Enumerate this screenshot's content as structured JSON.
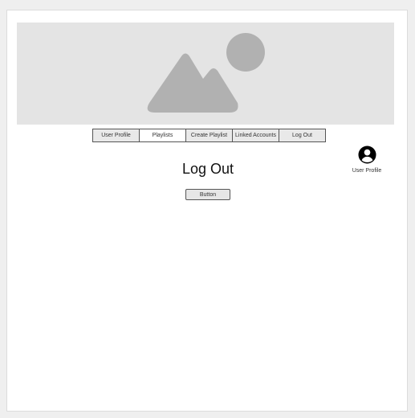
{
  "hero": {
    "icon": "image-placeholder-icon"
  },
  "nav": {
    "items": [
      {
        "label": "User Profile"
      },
      {
        "label": "Playlists",
        "active": true
      },
      {
        "label": "Create Playlist"
      },
      {
        "label": "Linked Accounts"
      },
      {
        "label": "Log Out"
      }
    ]
  },
  "main": {
    "title": "Log Out",
    "button_label": "Button"
  },
  "profile": {
    "icon": "account-circle-icon",
    "label": "User Profile"
  },
  "colors": {
    "background": "#efefef",
    "hero_bg": "#e4e4e4",
    "placeholder_shape": "#b1b1b1",
    "border": "#555555"
  }
}
